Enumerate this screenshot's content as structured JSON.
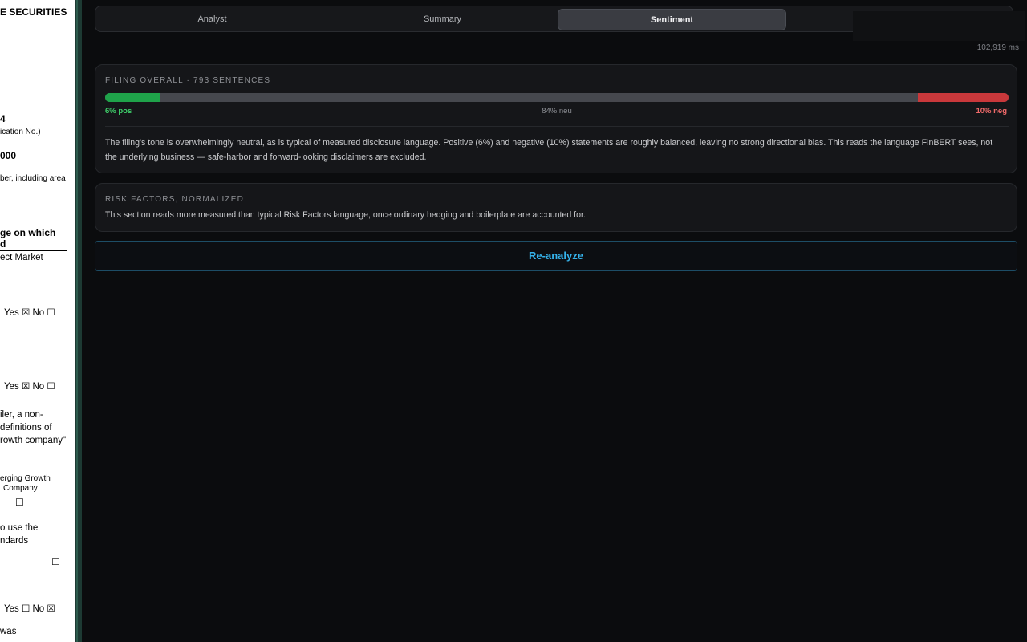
{
  "document_pane": {
    "lines": [
      {
        "text": "E SECURITIES",
        "bold": true
      },
      {
        "text": "4",
        "bold": true
      },
      {
        "text": "ication No.)",
        "bold": false
      },
      {
        "text": "000",
        "bold": true
      },
      {
        "text": "ber, including area",
        "bold": false
      },
      {
        "text": "ge on which",
        "bold": true
      },
      {
        "text": "d",
        "bold": true
      },
      {
        "text": "ect Market",
        "bold": false
      },
      {
        "text": "Yes ☒   No ☐",
        "bold": false
      },
      {
        "text": "Yes ☒   No ☐",
        "bold": false
      },
      {
        "text": "iler, a non-",
        "bold": false
      },
      {
        "text": "definitions of",
        "bold": false
      },
      {
        "text": "rowth company\"",
        "bold": false
      },
      {
        "text": "erging Growth",
        "bold": false
      },
      {
        "text": "Company",
        "bold": false
      },
      {
        "text": "☐",
        "bold": false
      },
      {
        "text": "o use the",
        "bold": false
      },
      {
        "text": "ndards",
        "bold": false
      },
      {
        "text": "☐",
        "bold": false
      },
      {
        "text": "Yes ☐   No ☒",
        "bold": false
      },
      {
        "text": "was",
        "bold": false
      }
    ]
  },
  "tabs": [
    {
      "label": "Analyst",
      "active": false
    },
    {
      "label": "Summary",
      "active": false
    },
    {
      "label": "Sentiment",
      "active": true
    }
  ],
  "timing": "102,919 ms",
  "overall": {
    "heading": "FILING OVERALL · 793 SENTENCES",
    "pos_fraction": 0.06,
    "neu_fraction": 0.84,
    "neg_fraction": 0.1,
    "pos_label": "6% pos",
    "neu_label": "84% neu",
    "neg_label": "10% neg",
    "colors": {
      "pos": "#1fa34a",
      "neu": "#46484e",
      "neg": "#c9383b"
    },
    "description": "The filing's tone is overwhelmingly neutral, as is typical of measured disclosure language. Positive (6%) and negative (10%) statements are roughly balanced, leaving no strong directional bias. This reads the language FinBERT sees, not the underlying business — safe-harbor and forward-looking disclaimers are excluded."
  },
  "risk_factors": {
    "heading": "RISK FACTORS, NORMALIZED",
    "description": "This section reads more measured than typical Risk Factors language, once ordinary hedging and boilerplate are accounted for."
  },
  "reanalyze_label": "Re-analyze",
  "accent_color": "#35b3ec"
}
